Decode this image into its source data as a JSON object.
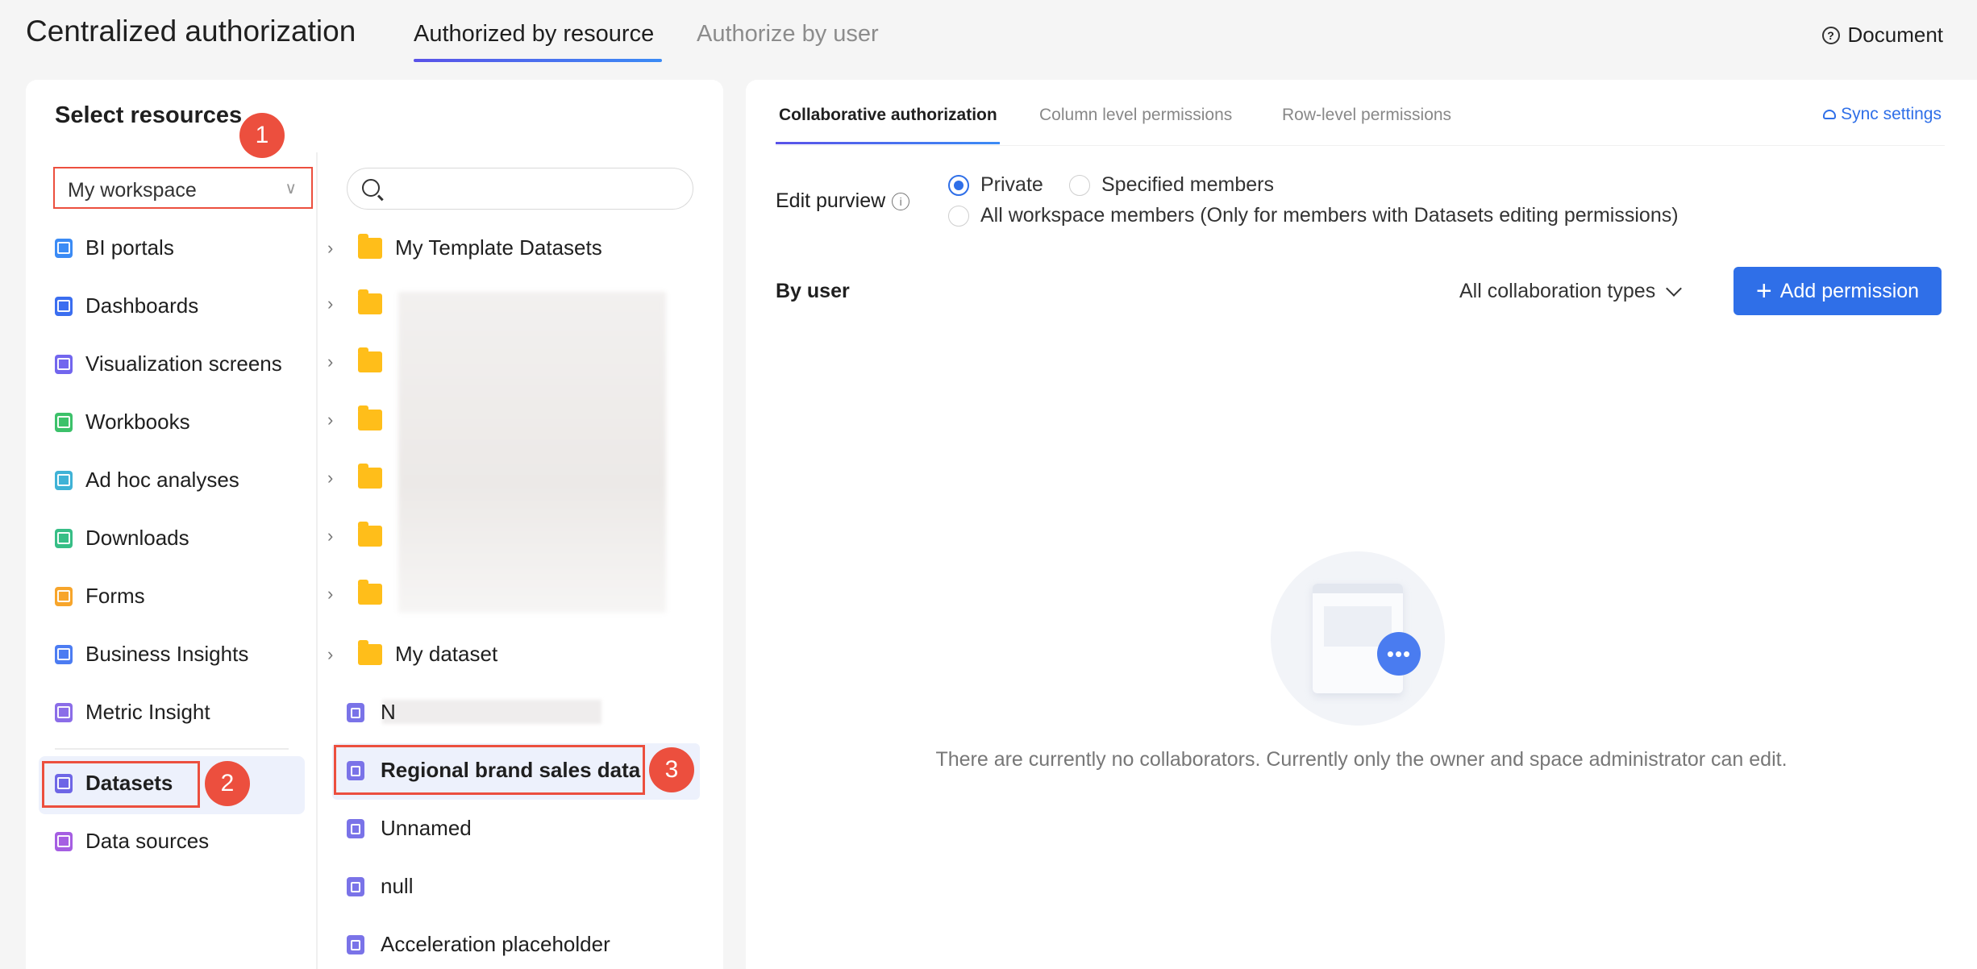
{
  "header": {
    "title": "Centralized authorization",
    "tabs": [
      "Authorized by resource",
      "Authorize by user"
    ],
    "document_label": "Document",
    "document_icon": "?"
  },
  "left": {
    "title": "Select resources",
    "workspace_select": "My workspace",
    "categories": [
      {
        "label": "BI portals",
        "icon": "bi-portal-icon",
        "color": "#3b8bf5"
      },
      {
        "label": "Dashboards",
        "icon": "dashboard-icon",
        "color": "#3b6ef0"
      },
      {
        "label": "Visualization screens",
        "icon": "screen-icon",
        "color": "#7266ee"
      },
      {
        "label": "Workbooks",
        "icon": "workbook-icon",
        "color": "#3cc16a"
      },
      {
        "label": "Ad hoc analyses",
        "icon": "adhoc-icon",
        "color": "#3fb2d6"
      },
      {
        "label": "Downloads",
        "icon": "download-icon",
        "color": "#37be86"
      },
      {
        "label": "Forms",
        "icon": "form-icon",
        "color": "#f7a52b"
      },
      {
        "label": "Business Insights",
        "icon": "insight-icon",
        "color": "#4c7cf2"
      },
      {
        "label": "Metric Insight",
        "icon": "metric-icon",
        "color": "#8b6de8"
      },
      {
        "label": "Datasets",
        "icon": "dataset-icon",
        "color": "#6e66e6"
      },
      {
        "label": "Data sources",
        "icon": "datasource-icon",
        "color": "#a55ee2"
      }
    ],
    "badges": [
      "1",
      "2",
      "3"
    ]
  },
  "tree": {
    "folders": [
      "My Template Datasets",
      "",
      "",
      "",
      "",
      "",
      "",
      "My dataset"
    ],
    "datasets": [
      "N",
      "Regional brand sales data",
      "Unnamed",
      "null",
      "Acceleration placeholder"
    ]
  },
  "right": {
    "tabs": [
      "Collaborative authorization",
      "Column level permissions",
      "Row-level permissions"
    ],
    "sync_label": "Sync settings",
    "edit_purview_label": "Edit purview",
    "radios": [
      "Private",
      "Specified members",
      "All workspace members (Only for members with Datasets editing permissions)"
    ],
    "by_user_label": "By user",
    "collab_select": "All collaboration types",
    "add_button": "Add permission",
    "add_icon": "+",
    "empty_text": "There are currently no collaborators. Currently only the owner and space administrator can edit.",
    "info_icon": "i",
    "bubble_icon": "•••"
  },
  "colors": {
    "accent": "#2f6fe8",
    "highlight": "#ec4f3e"
  }
}
